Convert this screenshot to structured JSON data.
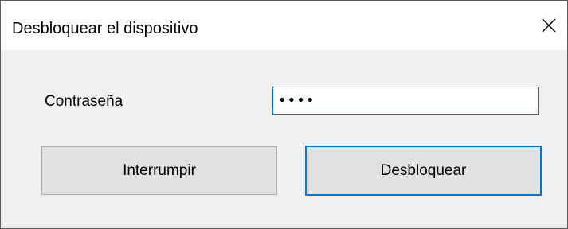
{
  "window": {
    "title": "Desbloquear el dispositivo",
    "close_icon": "close-icon"
  },
  "form": {
    "password_label": "Contraseña",
    "password_value": "1234"
  },
  "buttons": {
    "cancel_label": "Interrumpir",
    "unlock_label": "Desbloquear"
  },
  "colors": {
    "accent": "#0078d7",
    "button_face": "#e1e1e1",
    "dialog_background": "#f0f0f0"
  }
}
